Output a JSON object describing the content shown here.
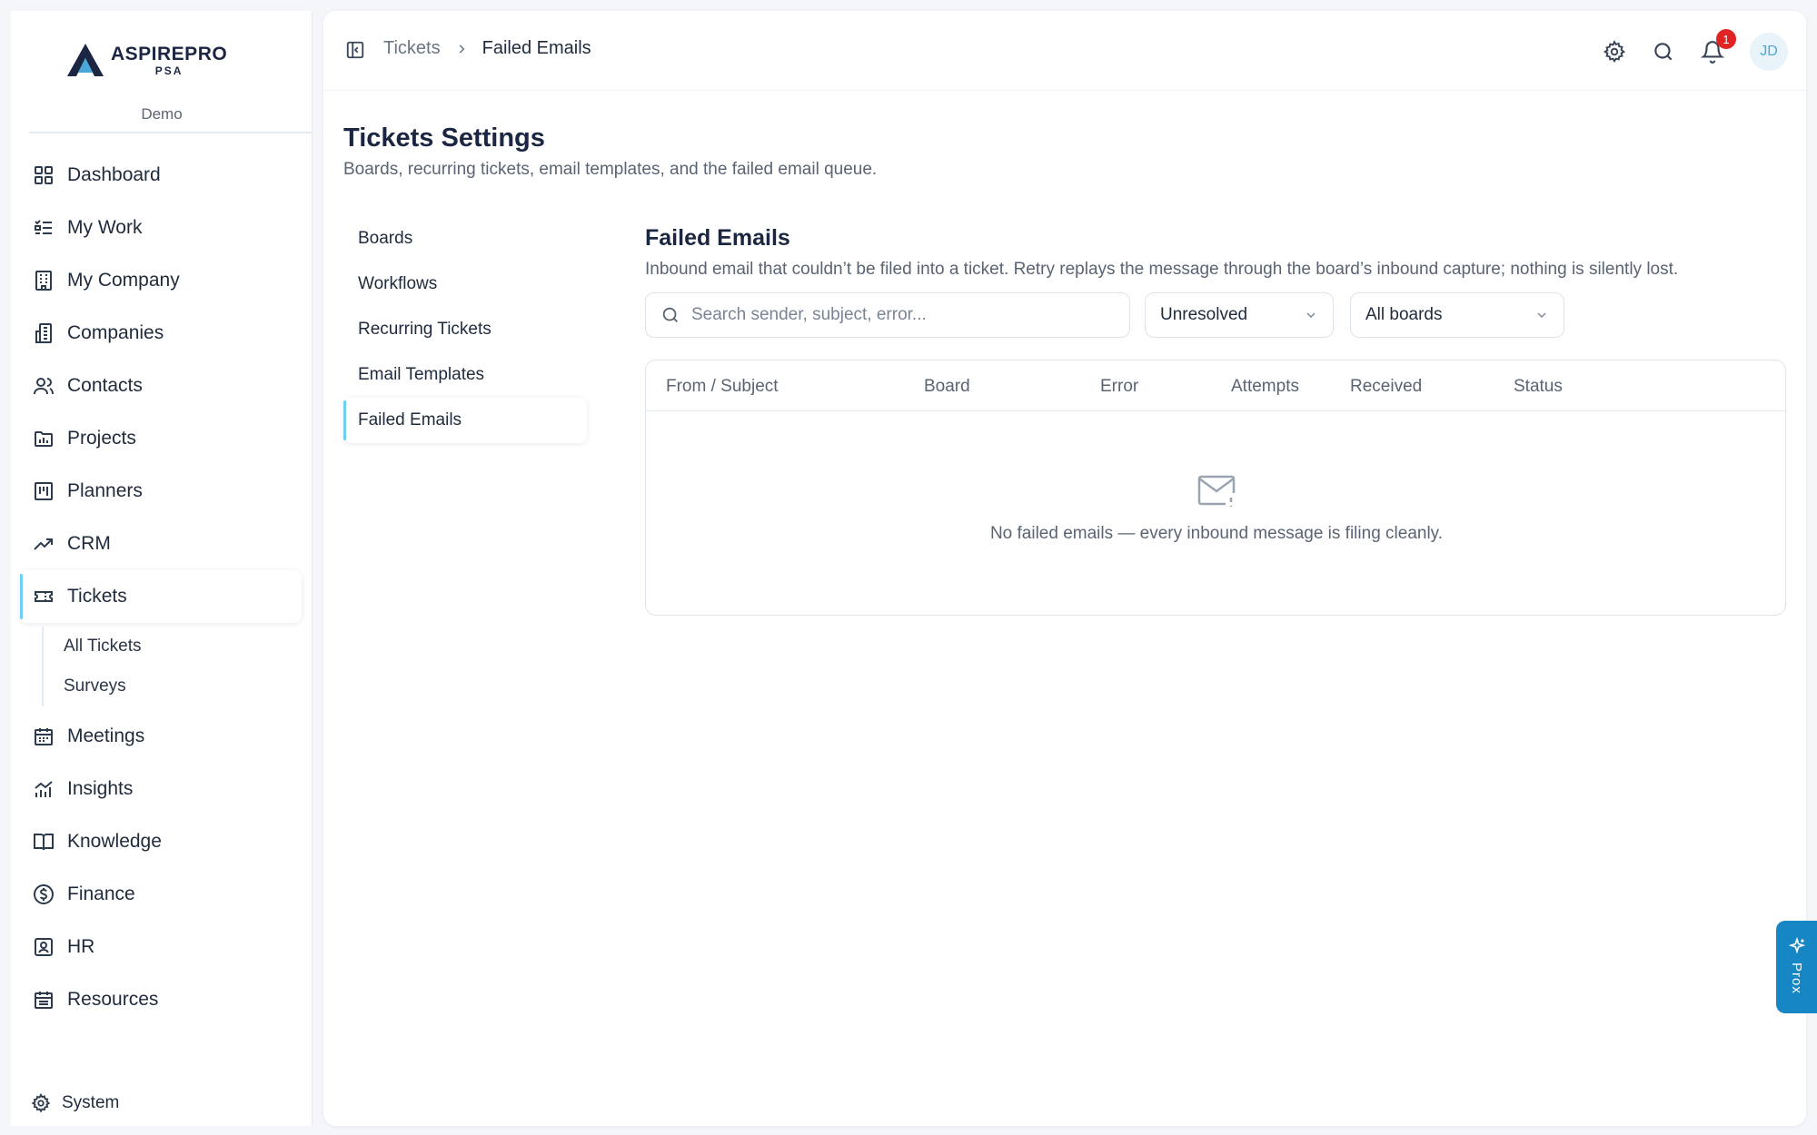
{
  "brand": {
    "title": "ASPIREPRO",
    "subtitle": "PSA",
    "workspace": "Demo"
  },
  "sidebar": {
    "items": [
      {
        "label": "Dashboard",
        "icon": "dashboard-icon"
      },
      {
        "label": "My Work",
        "icon": "list-check-icon"
      },
      {
        "label": "My Company",
        "icon": "building-icon"
      },
      {
        "label": "Companies",
        "icon": "buildings-icon"
      },
      {
        "label": "Contacts",
        "icon": "users-icon"
      },
      {
        "label": "Projects",
        "icon": "folder-chart-icon"
      },
      {
        "label": "Planners",
        "icon": "kanban-icon"
      },
      {
        "label": "CRM",
        "icon": "trend-up-icon"
      },
      {
        "label": "Tickets",
        "icon": "ticket-icon",
        "active": true
      },
      {
        "label": "Meetings",
        "icon": "calendar-icon"
      },
      {
        "label": "Insights",
        "icon": "chart-icon"
      },
      {
        "label": "Knowledge",
        "icon": "book-icon"
      },
      {
        "label": "Finance",
        "icon": "dollar-icon"
      },
      {
        "label": "HR",
        "icon": "id-badge-icon"
      },
      {
        "label": "Resources",
        "icon": "calendar-grid-icon"
      }
    ],
    "tickets_sub": [
      "All Tickets",
      "Surveys"
    ],
    "system_label": "System"
  },
  "topbar": {
    "breadcrumb": [
      "Tickets",
      "Failed Emails"
    ],
    "notifications_count": "1",
    "avatar_initials": "JD"
  },
  "page": {
    "title": "Tickets Settings",
    "subtitle": "Boards, recurring tickets, email templates, and the failed email queue."
  },
  "settings_nav": [
    "Boards",
    "Workflows",
    "Recurring Tickets",
    "Email Templates",
    "Failed Emails"
  ],
  "settings_nav_active": "Failed Emails",
  "section": {
    "title": "Failed Emails",
    "subtitle": "Inbound email that couldn’t be filed into a ticket. Retry replays the message through the board’s inbound capture; nothing is silently lost."
  },
  "filters": {
    "search_placeholder": "Search sender, subject, error...",
    "status_value": "Unresolved",
    "board_value": "All boards"
  },
  "table": {
    "columns": [
      "From / Subject",
      "Board",
      "Error",
      "Attempts",
      "Received",
      "Status"
    ],
    "empty_text": "No failed emails — every inbound message is filing cleanly."
  },
  "assistant": {
    "label": "Prox"
  },
  "colors": {
    "accent": "#6dd0f0",
    "assistant_bg": "#1686c4",
    "badge": "#e02424"
  }
}
